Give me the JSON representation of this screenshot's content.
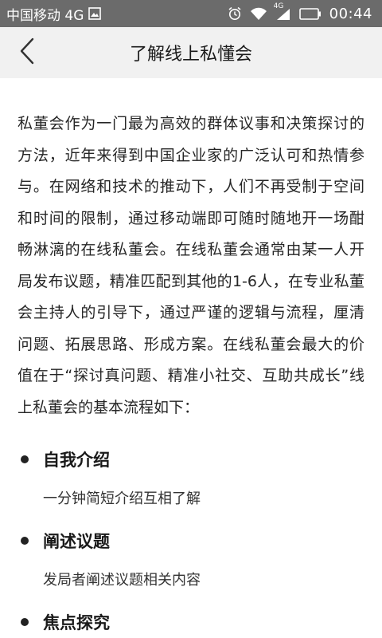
{
  "status_bar": {
    "carrier": "中国移动 4G",
    "network_badge": "4G",
    "time": "00:44",
    "icons": [
      "image-icon",
      "alarm-icon",
      "wifi-icon",
      "signal-icon",
      "battery-icon"
    ]
  },
  "app_bar": {
    "title": "了解线上私懂会",
    "back_icon": "chevron-left-icon"
  },
  "content": {
    "intro": "私董会作为一门最为高效的群体议事和决策探讨的方法，近年来得到中国企业家的广泛认可和热情参与。在网络和技术的推动下，人们不再受制于空间和时间的限制，通过移动端即可随时随地开一场酣畅淋漓的在线私董会。在线私董会通常由某一人开局发布议题，精准匹配到其他的1-6人，在专业私董会主持人的引导下，通过严谨的逻辑与流程，厘清问题、拓展思路、形成方案。在线私董会最大的价值在于“探讨真问题、精准小社交、互助共成长”线上私董会的基本流程如下：",
    "steps": [
      {
        "title": "自我介绍",
        "desc": "一分钟简短介绍互相了解"
      },
      {
        "title": "阐述议题",
        "desc": "发局者阐述议题相关内容"
      },
      {
        "title": "焦点探究",
        "desc": ""
      }
    ]
  }
}
